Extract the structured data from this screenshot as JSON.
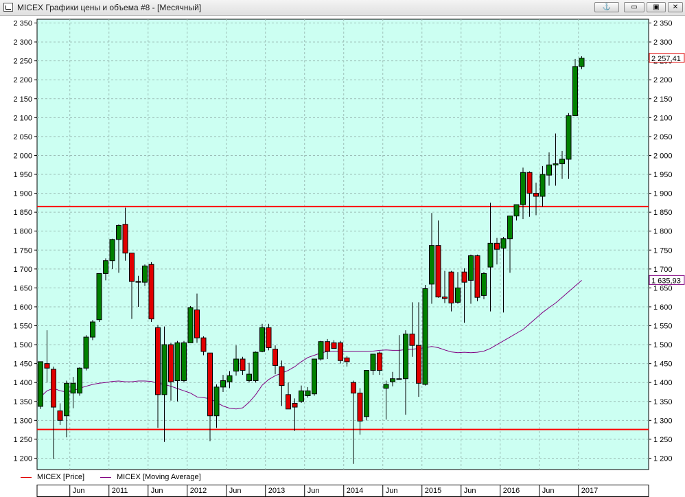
{
  "window": {
    "title": "MICEX Графики цены и объема #8 - [Месячный]",
    "buttons": [
      "⚓",
      "▭",
      "▣",
      "✕"
    ]
  },
  "legend": [
    {
      "label": "MICEX [Price]",
      "color": "#e00000"
    },
    {
      "label": "MICEX [Moving Average]",
      "color": "#800080"
    }
  ],
  "price_labels": {
    "last_price": "2 257,41",
    "ma_value": "1 635,93"
  },
  "colors": {
    "background": "#ccfff2",
    "bull": "#008000",
    "bear": "#e00000",
    "level_lines": "#ff0000",
    "moving_average": "#800080",
    "grid": "#9bbfb6"
  },
  "chart_data": {
    "type": "candlestick",
    "title": "",
    "xlabel": "",
    "ylabel": "",
    "ylim": [
      1170,
      2360
    ],
    "y_ticks": [
      {
        "v": 1200,
        "label": "1 200"
      },
      {
        "v": 1250,
        "label": "1 250"
      },
      {
        "v": 1300,
        "label": "1 300"
      },
      {
        "v": 1350,
        "label": "1 350"
      },
      {
        "v": 1400,
        "label": "1 400"
      },
      {
        "v": 1450,
        "label": "1 450"
      },
      {
        "v": 1500,
        "label": "1 500"
      },
      {
        "v": 1550,
        "label": "1 550"
      },
      {
        "v": 1600,
        "label": "1 600"
      },
      {
        "v": 1650,
        "label": "1 650"
      },
      {
        "v": 1700,
        "label": "1 700"
      },
      {
        "v": 1750,
        "label": "1 750"
      },
      {
        "v": 1800,
        "label": "1 800"
      },
      {
        "v": 1850,
        "label": "1 850"
      },
      {
        "v": 1900,
        "label": "1 900"
      },
      {
        "v": 1950,
        "label": "1 950"
      },
      {
        "v": 2000,
        "label": "2 000"
      },
      {
        "v": 2050,
        "label": "2 050"
      },
      {
        "v": 2100,
        "label": "2 100"
      },
      {
        "v": 2150,
        "label": "2 150"
      },
      {
        "v": 2200,
        "label": "2 200"
      },
      {
        "v": 2250,
        "label": "2 250"
      },
      {
        "v": 2300,
        "label": "2 300"
      },
      {
        "v": 2350,
        "label": "2 350"
      }
    ],
    "x_ticks": [
      {
        "i": 4.5,
        "label": "Jun"
      },
      {
        "i": 10.5,
        "label": "2011"
      },
      {
        "i": 16.5,
        "label": "Jun"
      },
      {
        "i": 22.5,
        "label": "2012"
      },
      {
        "i": 28.5,
        "label": "Jun"
      },
      {
        "i": 34.5,
        "label": "2013"
      },
      {
        "i": 40.5,
        "label": "Jun"
      },
      {
        "i": 46.5,
        "label": "2014"
      },
      {
        "i": 52.5,
        "label": "Jun"
      },
      {
        "i": 58.5,
        "label": "2015"
      },
      {
        "i": 64.5,
        "label": "Jun"
      },
      {
        "i": 70.5,
        "label": "2016"
      },
      {
        "i": 76.5,
        "label": "Jun"
      },
      {
        "i": 82.5,
        "label": "2017"
      }
    ],
    "horizontal_lines": [
      1865,
      1276
    ],
    "candles": [
      {
        "o": 1337,
        "h": 1455,
        "l": 1330,
        "c": 1455
      },
      {
        "o": 1450,
        "h": 1538,
        "l": 1400,
        "c": 1438
      },
      {
        "o": 1435,
        "h": 1442,
        "l": 1198,
        "c": 1335
      },
      {
        "o": 1325,
        "h": 1345,
        "l": 1288,
        "c": 1300
      },
      {
        "o": 1312,
        "h": 1405,
        "l": 1255,
        "c": 1398
      },
      {
        "o": 1372,
        "h": 1415,
        "l": 1332,
        "c": 1398
      },
      {
        "o": 1372,
        "h": 1440,
        "l": 1365,
        "c": 1438
      },
      {
        "o": 1438,
        "h": 1525,
        "l": 1432,
        "c": 1520
      },
      {
        "o": 1520,
        "h": 1565,
        "l": 1512,
        "c": 1560
      },
      {
        "o": 1566,
        "h": 1688,
        "l": 1560,
        "c": 1688
      },
      {
        "o": 1688,
        "h": 1728,
        "l": 1670,
        "c": 1722
      },
      {
        "o": 1722,
        "h": 1780,
        "l": 1700,
        "c": 1778
      },
      {
        "o": 1778,
        "h": 1818,
        "l": 1690,
        "c": 1815
      },
      {
        "o": 1818,
        "h": 1862,
        "l": 1722,
        "c": 1742
      },
      {
        "o": 1742,
        "h": 1742,
        "l": 1568,
        "c": 1667
      },
      {
        "o": 1667,
        "h": 1682,
        "l": 1600,
        "c": 1665
      },
      {
        "o": 1665,
        "h": 1712,
        "l": 1655,
        "c": 1708
      },
      {
        "o": 1712,
        "h": 1718,
        "l": 1560,
        "c": 1568
      },
      {
        "o": 1545,
        "h": 1552,
        "l": 1280,
        "c": 1368
      },
      {
        "o": 1368,
        "h": 1548,
        "l": 1243,
        "c": 1500
      },
      {
        "o": 1500,
        "h": 1505,
        "l": 1352,
        "c": 1402
      },
      {
        "o": 1405,
        "h": 1510,
        "l": 1350,
        "c": 1505
      },
      {
        "o": 1405,
        "h": 1510,
        "l": 1400,
        "c": 1505
      },
      {
        "o": 1505,
        "h": 1602,
        "l": 1505,
        "c": 1598
      },
      {
        "o": 1592,
        "h": 1635,
        "l": 1505,
        "c": 1518
      },
      {
        "o": 1518,
        "h": 1522,
        "l": 1472,
        "c": 1482
      },
      {
        "o": 1478,
        "h": 1478,
        "l": 1245,
        "c": 1312
      },
      {
        "o": 1312,
        "h": 1395,
        "l": 1280,
        "c": 1388
      },
      {
        "o": 1388,
        "h": 1420,
        "l": 1375,
        "c": 1405
      },
      {
        "o": 1402,
        "h": 1430,
        "l": 1385,
        "c": 1418
      },
      {
        "o": 1430,
        "h": 1498,
        "l": 1418,
        "c": 1462
      },
      {
        "o": 1462,
        "h": 1468,
        "l": 1420,
        "c": 1432
      },
      {
        "o": 1405,
        "h": 1452,
        "l": 1400,
        "c": 1422
      },
      {
        "o": 1405,
        "h": 1482,
        "l": 1400,
        "c": 1480
      },
      {
        "o": 1482,
        "h": 1555,
        "l": 1480,
        "c": 1545
      },
      {
        "o": 1545,
        "h": 1555,
        "l": 1485,
        "c": 1492
      },
      {
        "o": 1488,
        "h": 1498,
        "l": 1422,
        "c": 1445
      },
      {
        "o": 1442,
        "h": 1458,
        "l": 1338,
        "c": 1392
      },
      {
        "o": 1368,
        "h": 1400,
        "l": 1330,
        "c": 1330
      },
      {
        "o": 1345,
        "h": 1358,
        "l": 1272,
        "c": 1335
      },
      {
        "o": 1350,
        "h": 1392,
        "l": 1346,
        "c": 1378
      },
      {
        "o": 1365,
        "h": 1388,
        "l": 1360,
        "c": 1378
      },
      {
        "o": 1370,
        "h": 1440,
        "l": 1365,
        "c": 1462
      },
      {
        "o": 1462,
        "h": 1510,
        "l": 1458,
        "c": 1508
      },
      {
        "o": 1508,
        "h": 1515,
        "l": 1462,
        "c": 1482
      },
      {
        "o": 1505,
        "h": 1512,
        "l": 1490,
        "c": 1490
      },
      {
        "o": 1505,
        "h": 1510,
        "l": 1450,
        "c": 1458
      },
      {
        "o": 1465,
        "h": 1470,
        "l": 1442,
        "c": 1455
      },
      {
        "o": 1400,
        "h": 1405,
        "l": 1185,
        "c": 1372
      },
      {
        "o": 1372,
        "h": 1385,
        "l": 1262,
        "c": 1298
      },
      {
        "o": 1310,
        "h": 1432,
        "l": 1300,
        "c": 1432
      },
      {
        "o": 1432,
        "h": 1475,
        "l": 1420,
        "c": 1475
      },
      {
        "o": 1478,
        "h": 1482,
        "l": 1420,
        "c": 1432
      },
      {
        "o": 1385,
        "h": 1405,
        "l": 1302,
        "c": 1395
      },
      {
        "o": 1402,
        "h": 1428,
        "l": 1390,
        "c": 1410
      },
      {
        "o": 1410,
        "h": 1525,
        "l": 1408,
        "c": 1410
      },
      {
        "o": 1410,
        "h": 1538,
        "l": 1315,
        "c": 1528
      },
      {
        "o": 1528,
        "h": 1612,
        "l": 1468,
        "c": 1498
      },
      {
        "o": 1498,
        "h": 1612,
        "l": 1362,
        "c": 1398
      },
      {
        "o": 1395,
        "h": 1658,
        "l": 1392,
        "c": 1648
      },
      {
        "o": 1660,
        "h": 1848,
        "l": 1608,
        "c": 1762
      },
      {
        "o": 1762,
        "h": 1828,
        "l": 1624,
        "c": 1626
      },
      {
        "o": 1626,
        "h": 1695,
        "l": 1610,
        "c": 1622
      },
      {
        "o": 1692,
        "h": 1695,
        "l": 1588,
        "c": 1610
      },
      {
        "o": 1612,
        "h": 1692,
        "l": 1608,
        "c": 1650
      },
      {
        "o": 1692,
        "h": 1702,
        "l": 1558,
        "c": 1665
      },
      {
        "o": 1670,
        "h": 1738,
        "l": 1608,
        "c": 1735
      },
      {
        "o": 1735,
        "h": 1738,
        "l": 1615,
        "c": 1625
      },
      {
        "o": 1630,
        "h": 1692,
        "l": 1620,
        "c": 1688
      },
      {
        "o": 1705,
        "h": 1875,
        "l": 1588,
        "c": 1768
      },
      {
        "o": 1768,
        "h": 1782,
        "l": 1712,
        "c": 1752
      },
      {
        "o": 1755,
        "h": 1785,
        "l": 1585,
        "c": 1780
      },
      {
        "o": 1780,
        "h": 1808,
        "l": 1690,
        "c": 1840
      },
      {
        "o": 1840,
        "h": 1865,
        "l": 1828,
        "c": 1870
      },
      {
        "o": 1870,
        "h": 1968,
        "l": 1832,
        "c": 1955
      },
      {
        "o": 1955,
        "h": 1958,
        "l": 1838,
        "c": 1900
      },
      {
        "o": 1900,
        "h": 1928,
        "l": 1842,
        "c": 1892
      },
      {
        "o": 1892,
        "h": 1972,
        "l": 1865,
        "c": 1950
      },
      {
        "o": 1948,
        "h": 2008,
        "l": 1920,
        "c": 1975
      },
      {
        "o": 1975,
        "h": 2058,
        "l": 1920,
        "c": 1978
      },
      {
        "o": 1978,
        "h": 2012,
        "l": 1938,
        "c": 1990
      },
      {
        "o": 1990,
        "h": 2112,
        "l": 1938,
        "c": 2105
      },
      {
        "o": 2105,
        "h": 2255,
        "l": 2105,
        "c": 2235
      },
      {
        "o": 2235,
        "h": 2262,
        "l": 2228,
        "c": 2257
      }
    ],
    "moving_average": {
      "name": "MICEX [Moving Average]",
      "start_index": 0,
      "values": [
        1362,
        1378,
        1385,
        1378,
        1375,
        1378,
        1385,
        1390,
        1395,
        1398,
        1400,
        1403,
        1404,
        1402,
        1402,
        1404,
        1404,
        1403,
        1398,
        1395,
        1390,
        1384,
        1378,
        1372,
        1362,
        1360,
        1357,
        1347,
        1338,
        1332,
        1330,
        1333,
        1348,
        1368,
        1393,
        1408,
        1418,
        1425,
        1432,
        1442,
        1455,
        1466,
        1472,
        1478,
        1482,
        1483,
        1482,
        1482,
        1482,
        1482,
        1482,
        1483,
        1485,
        1486,
        1485,
        1485,
        1487,
        1488,
        1490,
        1492,
        1495,
        1492,
        1486,
        1481,
        1479,
        1480,
        1479,
        1480,
        1483,
        1490,
        1500,
        1510,
        1520,
        1530,
        1540,
        1555,
        1570,
        1585,
        1598,
        1610,
        1625,
        1640,
        1655,
        1670
      ]
    }
  },
  "timeline_labels": [
    "Jun",
    "2011",
    "Jun",
    "2012",
    "Jun",
    "2013",
    "Jun",
    "2014",
    "Jun",
    "2015",
    "Jun",
    "2016",
    "Jun",
    "2017"
  ]
}
